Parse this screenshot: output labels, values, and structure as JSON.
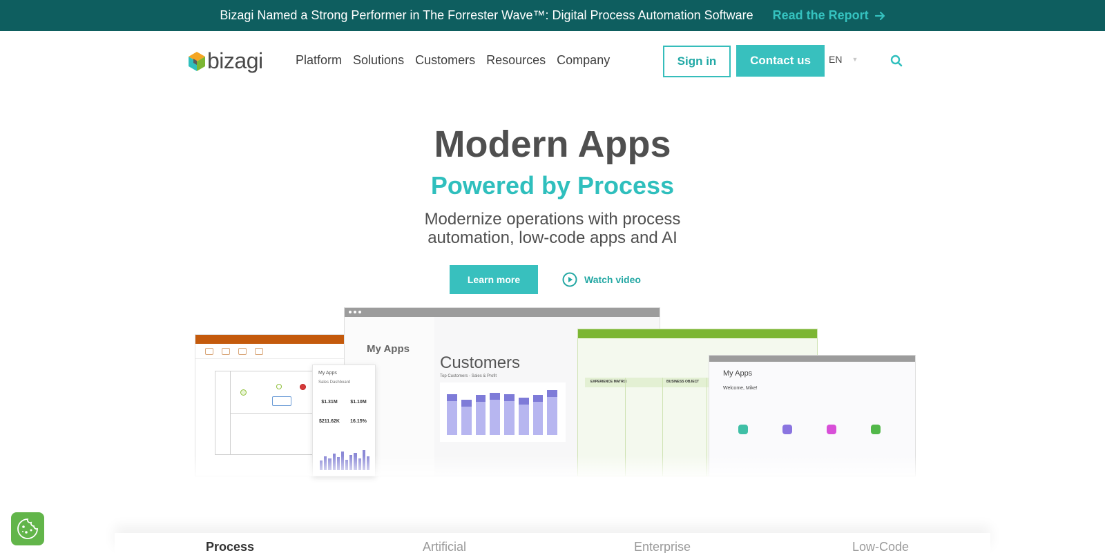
{
  "announcement": {
    "text": "Bizagi Named a Strong Performer in The Forrester Wave™: Digital Process Automation Software",
    "link_label": "Read the Report",
    "link_icon": "arrow-right-icon"
  },
  "header": {
    "logo_text": "bizagi",
    "nav": [
      "Platform",
      "Solutions",
      "Customers",
      "Resources",
      "Company"
    ],
    "signin_label": "Sign in",
    "contact_label": "Contact us",
    "language": "EN",
    "search_icon": "search-icon"
  },
  "hero": {
    "title": "Modern Apps",
    "subtitle": "Powered by Process",
    "description": "Modernize operations with process automation, low-code apps and AI",
    "primary_cta": "Learn more",
    "secondary_cta": "Watch video"
  },
  "mockups": {
    "center_sidebar_title": "My Apps",
    "center_page_title": "Customers",
    "center_chart_caption": "Top Customers - Sales & Profit",
    "phone_title": "My Apps",
    "phone_subtitle": "Sales Dashboard",
    "phone_stats": [
      "$1.31M",
      "$1.10M",
      "$211.62K",
      "16.15%"
    ],
    "green_headers": [
      "EXPERIENCE MATRIX",
      "BUSINESS OBJECT"
    ],
    "right_title": "My Apps",
    "right_greeting": "Welcome, Mike!"
  },
  "bottom_tabs": [
    "Process",
    "Artificial",
    "Enterprise",
    "Low-Code"
  ],
  "colors": {
    "announcement_bg": "#0e5e5f",
    "accent": "#38c0be",
    "heading": "#4f4f4f"
  }
}
